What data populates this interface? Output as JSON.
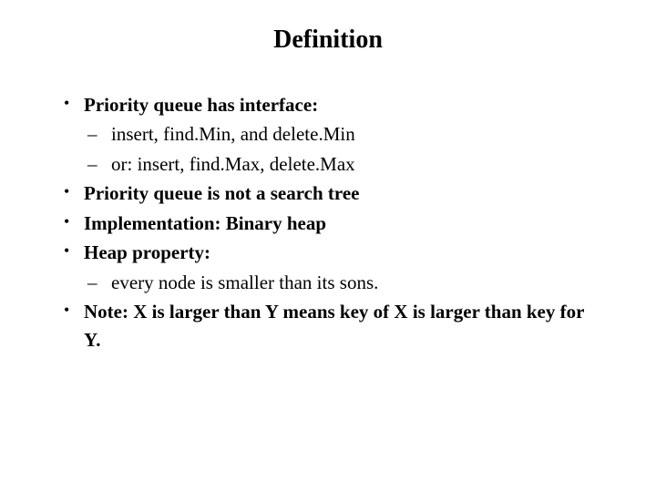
{
  "title": "Definition",
  "items": {
    "b1": "Priority queue has interface:",
    "b1_s1": " insert, find.Min, and delete.Min",
    "b1_s2": "or: insert, find.Max, delete.Max",
    "b2": "Priority queue is not a search tree",
    "b3": "Implementation: Binary heap",
    "b4": "Heap property:",
    "b4_s1": "every node is smaller than its sons.",
    "b5": "Note: X is larger than Y means key of X is larger than key for Y."
  }
}
